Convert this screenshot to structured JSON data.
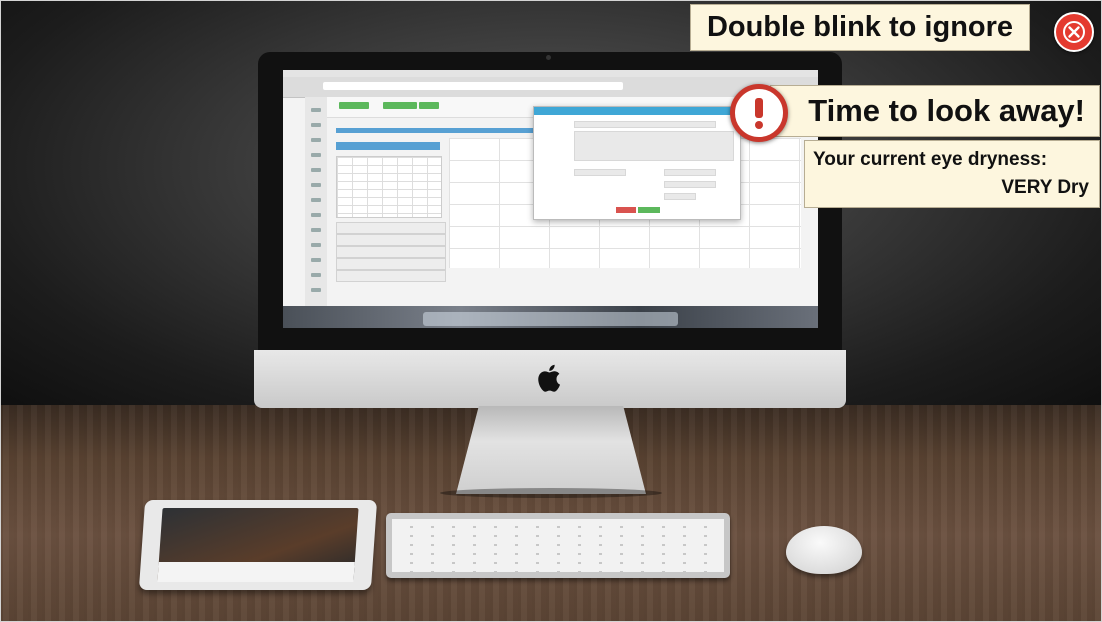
{
  "overlay": {
    "ignore_prompt": "Double blink to ignore",
    "alert_title": "Time to look away!",
    "dryness_label": "Your current eye dryness:",
    "dryness_value": "VERY Dry",
    "icons": {
      "close": "close-icon",
      "alert": "exclamation-icon"
    },
    "colors": {
      "panel_background": "#fdf6de",
      "alert_red": "#c9372c",
      "close_red": "#e43a2f"
    }
  },
  "scene": {
    "icons": {
      "apple": "apple-logo-icon"
    }
  }
}
